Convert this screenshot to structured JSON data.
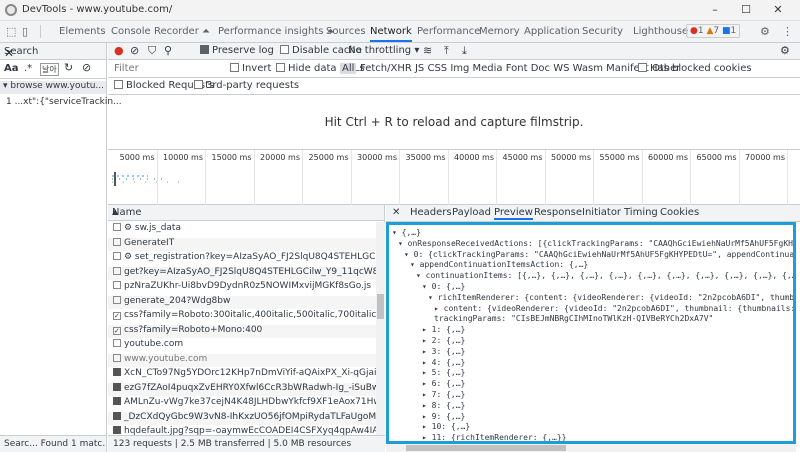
{
  "window": {
    "title": "DevTools - www.youtube.com/",
    "minimize": "–",
    "maximize": "☐",
    "close": "✕"
  },
  "tabs": [
    {
      "label": "Elements"
    },
    {
      "label": "Console"
    },
    {
      "label": "Recorder ⏶"
    },
    {
      "label": "Performance insights ⏶"
    },
    {
      "label": "Sources"
    },
    {
      "label": "Network"
    },
    {
      "label": "Performance"
    },
    {
      "label": "Memory"
    },
    {
      "label": "Application"
    },
    {
      "label": "Security"
    },
    {
      "label": "Lighthouse"
    }
  ],
  "active_tab": "Network",
  "badges": {
    "errors": "1",
    "warnings": "7",
    "info": "1"
  },
  "search_panel": {
    "title": "Search",
    "close": "✕",
    "case_label": "Aa",
    "regex_label": ".*",
    "result_group": "▾ browse   www.youtu...",
    "result_line": "1  ...xt\":{\"serviceTrackin...",
    "status": "Searc...  Found 1 matc..."
  },
  "toolbar": {
    "preserve_log": "Preserve log",
    "disable_cache": "Disable cache",
    "throttling": "No throttling",
    "throttle_arrow": "▾"
  },
  "filter": {
    "placeholder": "Filter",
    "invert": "Invert",
    "hide_data_urls": "Hide data URLs",
    "all": "All",
    "types": "Fetch/XHR  JS  CSS  Img  Media  Font  Doc  WS  Wasm  Manifest  Other",
    "blocked_cookies": "Has blocked cookies",
    "blocked_requests": "Blocked Requests",
    "third_party": "3rd-party requests"
  },
  "filmstrip_message": "Hit Ctrl + R to reload and capture filmstrip.",
  "timeline_ticks": [
    "5000 ms",
    "10000 ms",
    "15000 ms",
    "20000 ms",
    "25000 ms",
    "30000 ms",
    "35000 ms",
    "40000 ms",
    "45000 ms",
    "50000 ms",
    "55000 ms",
    "60000 ms",
    "65000 ms",
    "70000 ms"
  ],
  "request_list": {
    "header": "Name",
    "sort_icon": "▲",
    "items": [
      {
        "name": "⚙ sw.js_data",
        "icon": "empty"
      },
      {
        "name": "GenerateIT",
        "icon": "empty"
      },
      {
        "name": "⚙ set_registration?key=AIzaSyAO_FJ2SlqU8Q4STEHLGCilw_Y9_11qcW",
        "icon": "empty"
      },
      {
        "name": "get?key=AIzaSyAO_FJ2SlqU8Q4STEHLGCilw_Y9_11qcW8&prettyPrint...",
        "icon": "empty"
      },
      {
        "name": "pzNraZUKhr-Ui8bvD9DydnR0z5NOWIMxvijMGKf8sGo.js",
        "icon": "empty"
      },
      {
        "name": "generate_204?Wdg8bw",
        "icon": "empty"
      },
      {
        "name": "css?family=Roboto:300italic,400italic,500italic,700italic",
        "icon": "checked"
      },
      {
        "name": "css?family=Roboto+Mono:400",
        "icon": "checked"
      },
      {
        "name": "youtube.com",
        "icon": "empty"
      },
      {
        "name": "www.youtube.com",
        "icon": "empty",
        "grey": true
      },
      {
        "name": "XcN_CTo97Ng5YDOrc12KHp7nDmViYif-aQAixPX_Xi-qGjaitMpF4Lr1b...",
        "icon": "dark"
      },
      {
        "name": "ezG7fZAoI4puqxZvEHRY0Xfwl6CcR3bWRadwh-Ig_-iSuBw9aK...pJuR5...",
        "icon": "dark"
      },
      {
        "name": "AMLnZu-vWg7ke37cejN4K48JLHDbwYkfcf9XF1eAox71Hw=s68-c-k-c...",
        "icon": "dark"
      },
      {
        "name": "_DzCXdQyGbc9W3vN8-IhKxzUO56jfOMpiRydaTLFaUgoMCqTCAebdC...",
        "icon": "dark"
      },
      {
        "name": "hqdefault.jpg?sqp=-oaymwEcCOADEI4CSFXyq4qpAw4IARUAAIhCGAJo...",
        "icon": "dark"
      }
    ],
    "status": "123 requests  |  2.5 MB transferred  |  5.0 MB resources"
  },
  "detail_tabs": [
    {
      "label": "✕"
    },
    {
      "label": "Headers"
    },
    {
      "label": "Payload"
    },
    {
      "label": "Preview"
    },
    {
      "label": "Response"
    },
    {
      "label": "Initiator"
    },
    {
      "label": "Timing"
    },
    {
      "label": "Cookies"
    }
  ],
  "active_detail_tab": "Preview",
  "preview_lines": [
    {
      "indent": 0,
      "text": "▾ {,…}"
    },
    {
      "indent": 1,
      "text": "▾ onResponseReceivedActions: [{clickTrackingParams: \"CAAQhGciEwiehNaUrMf5AhUF5FgKHYPED\""
    },
    {
      "indent": 2,
      "text": "▾ 0: {clickTrackingParams: \"CAAQhGciEwiehNaUrMf5AhUF5FgKHYPEDtU=\", appendContinuation"
    },
    {
      "indent": 3,
      "text": "▾ appendContinuationItemsAction: {,…}"
    },
    {
      "indent": 4,
      "text": "▾ continuationItems: [{,…}, {,…}, {,…}, {,…}, {,…}, {,…}, {,…}, {,…}, {,…}, {,…},"
    },
    {
      "indent": 5,
      "text": "▾ 0: {,…}"
    },
    {
      "indent": 6,
      "text": "▾ richItemRenderer: {content: {videoRenderer: {videoId: \"2n2pcobA6DI\", thumbna"
    },
    {
      "indent": 7,
      "text": "▸ content: {videoRenderer: {videoId: \"2n2pcobA6DI\", thumbnail: {thumbnails:"
    },
    {
      "indent": 7,
      "text": "  trackingParams: \"CIsBEJmNBRgCIhMInoTWlKzH-QIVBeRYCh2DxA7V\""
    },
    {
      "indent": 5,
      "text": "▸ 1: {,…}"
    },
    {
      "indent": 5,
      "text": "▸ 2: {,…}"
    },
    {
      "indent": 5,
      "text": "▸ 3: {,…}"
    },
    {
      "indent": 5,
      "text": "▸ 4: {,…}"
    },
    {
      "indent": 5,
      "text": "▸ 5: {,…}"
    },
    {
      "indent": 5,
      "text": "▸ 6: {,…}"
    },
    {
      "indent": 5,
      "text": "▸ 7: {,…}"
    },
    {
      "indent": 5,
      "text": "▸ 8: {,…}"
    },
    {
      "indent": 5,
      "text": "▸ 9: {,…}"
    },
    {
      "indent": 5,
      "text": "▸ 10: {,…}"
    },
    {
      "indent": 5,
      "text": "▸ 11: {richItemRenderer: {,…}}"
    }
  ],
  "colors": {
    "accent": "#1a73e8",
    "highlight_border": "#1e9ed6"
  }
}
